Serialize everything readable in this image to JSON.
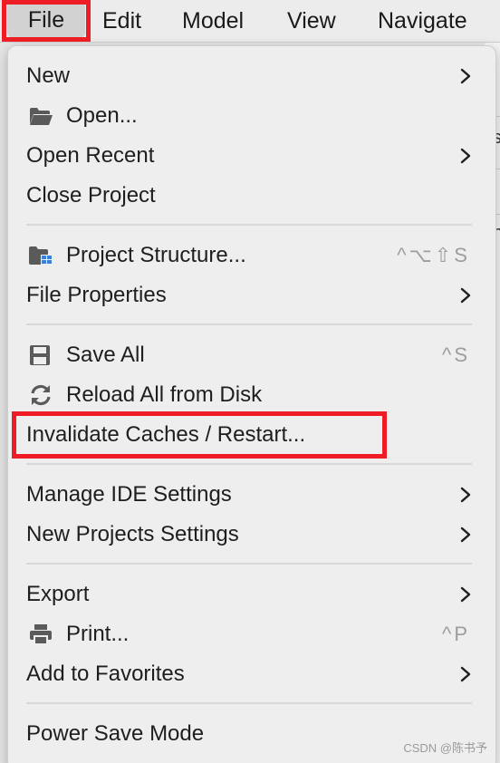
{
  "menubar": {
    "items": [
      {
        "label": "File"
      },
      {
        "label": "Edit"
      },
      {
        "label": "Model"
      },
      {
        "label": "View"
      },
      {
        "label": "Navigate"
      }
    ]
  },
  "menu": {
    "new": {
      "label": "New"
    },
    "open": {
      "label": "Open...",
      "icon": "folder-icon"
    },
    "open_recent": {
      "label": "Open Recent"
    },
    "close_project": {
      "label": "Close Project"
    },
    "project_structure": {
      "label": "Project Structure...",
      "icon": "project-structure-icon",
      "shortcut": "^⌥⇧S"
    },
    "file_properties": {
      "label": "File Properties"
    },
    "save_all": {
      "label": "Save All",
      "icon": "save-icon",
      "shortcut": "^S"
    },
    "reload": {
      "label": "Reload All from Disk",
      "icon": "reload-icon"
    },
    "invalidate": {
      "label": "Invalidate Caches / Restart..."
    },
    "manage_ide": {
      "label": "Manage IDE Settings"
    },
    "new_projects_settings": {
      "label": "New Projects Settings"
    },
    "export": {
      "label": "Export"
    },
    "print": {
      "label": "Print...",
      "icon": "printer-icon",
      "shortcut": "^P"
    },
    "add_favorites": {
      "label": "Add to Favorites"
    },
    "power_save": {
      "label": "Power Save Mode"
    }
  },
  "background": {
    "glyph_1": "s",
    "glyph_2": "n"
  },
  "watermark": "CSDN @陈书予",
  "colors": {
    "highlight_box": "#ee1c25",
    "menu_bg": "#eeeeee",
    "shortcut_text": "#9d9d9d"
  }
}
